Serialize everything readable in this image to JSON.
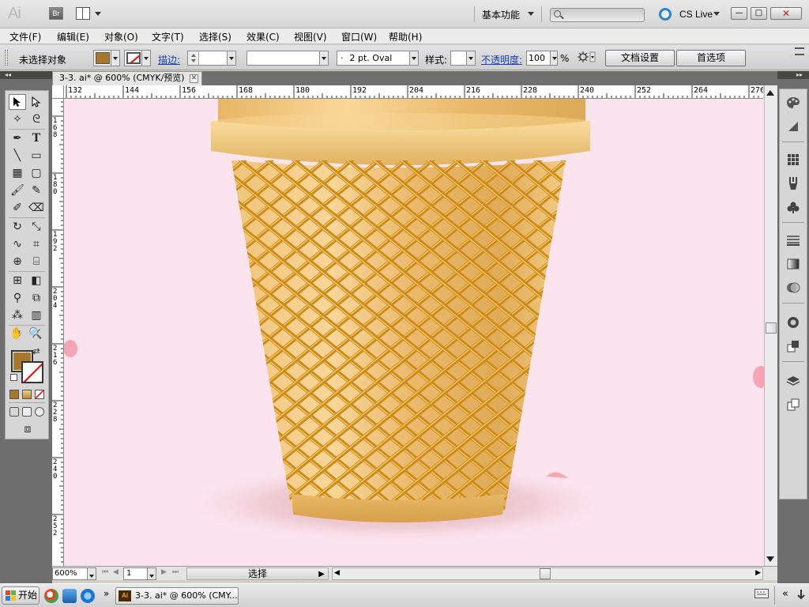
{
  "app": {
    "logo": "Ai",
    "bridge_label": "Br",
    "workspace": "基本功能",
    "cs_live": "CS Live",
    "search_placeholder": "",
    "window_buttons": {
      "minimize": "—",
      "restore": "□",
      "close": "✕"
    }
  },
  "menu": [
    "文件(F)",
    "编辑(E)",
    "对象(O)",
    "文字(T)",
    "选择(S)",
    "效果(C)",
    "视图(V)",
    "窗口(W)",
    "帮助(H)"
  ],
  "control_bar": {
    "selection_status": "未选择对象",
    "stroke_label": "描边:",
    "stroke_value": "",
    "variable_width": "",
    "brush": "2 pt. Oval",
    "brush_prefix": "·",
    "style_label": "样式:",
    "opacity_label": "不透明度:",
    "opacity_value": "100",
    "opacity_unit": "%",
    "doc_setup_button": "文档设置",
    "preferences_button": "首选项",
    "fill_color": "#a6782c"
  },
  "document": {
    "tab_title": "3-3. ai* @ 600% (CMYK/预览)",
    "close_glyph": "✕"
  },
  "ruler": {
    "horizontal": [
      "132",
      "144",
      "156",
      "168",
      "180",
      "192",
      "204",
      "216",
      "228",
      "240",
      "252",
      "264",
      "276"
    ],
    "vertical": [
      "168",
      "180",
      "192",
      "204",
      "216",
      "228",
      "240",
      "252"
    ]
  },
  "status_bar": {
    "zoom": "600%",
    "page": "1",
    "status": "选择"
  },
  "taskbar": {
    "start": "开始",
    "task_item": "3-3. ai* @ 600% (CMY...",
    "more_glyph": "»",
    "tray_glyph": "«"
  },
  "colors": {
    "canvas_bg": "#fce4ee",
    "cone_light": "#f8d493",
    "cone_dark": "#d4a04c",
    "grid": "#c98a1e"
  }
}
